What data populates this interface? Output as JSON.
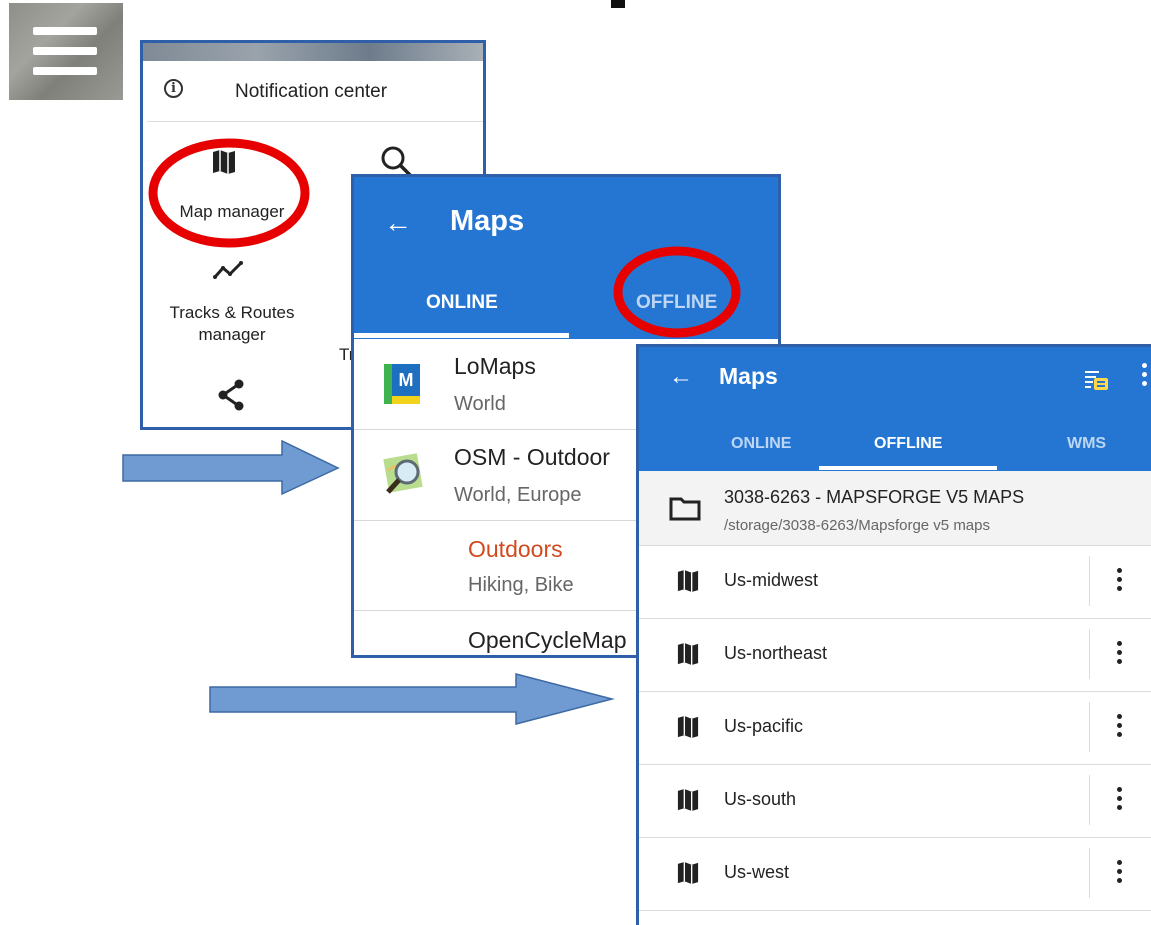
{
  "menu": {
    "notification_center": "Notification center",
    "items": [
      {
        "label_line1": "Map manager",
        "label_line2": "",
        "icon": "map-icon"
      },
      {
        "label_line1": "Tracks & Routes",
        "label_line2": "manager",
        "icon": "track-icon"
      },
      {
        "label_line1": "Tr",
        "label_line2": "",
        "icon": "search-icon"
      },
      {
        "label_line1": "",
        "label_line2": "",
        "icon": "share-icon"
      }
    ]
  },
  "maps_online": {
    "title": "Maps",
    "tabs": [
      "ONLINE",
      "OFFLINE"
    ],
    "rows": [
      {
        "title": "LoMaps",
        "subtitle": "World",
        "icon": "lomaps-logo"
      },
      {
        "title": "OSM - Outdoor",
        "subtitle": "World, Europe",
        "icon": "osm-logo"
      },
      {
        "title": "Outdoors",
        "subtitle": "Hiking, Bike",
        "icon": ""
      },
      {
        "title": "OpenCycleMap",
        "subtitle": "",
        "icon": ""
      }
    ],
    "highlight_color": "#d14a1f"
  },
  "maps_offline": {
    "title": "Maps",
    "tabs": [
      "ONLINE",
      "OFFLINE",
      "WMS"
    ],
    "folder": {
      "title": "3038-6263 - MAPSFORGE V5 MAPS",
      "path": "/storage/3038-6263/Mapsforge v5 maps"
    },
    "maps": [
      "Us-midwest",
      "Us-northeast",
      "Us-pacific",
      "Us-south",
      "Us-west"
    ]
  },
  "colors": {
    "toolbar": "#2576d2",
    "annotation_circle": "#e60000",
    "arrow_fill": "#6f9bd2",
    "panel_border": "#2e5fa8"
  }
}
